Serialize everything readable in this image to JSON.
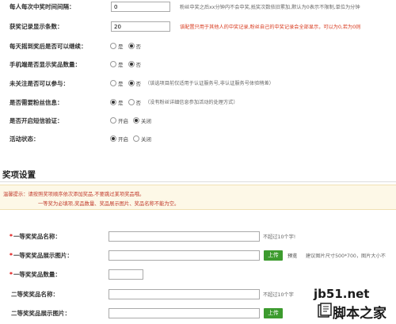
{
  "settings": {
    "interval": {
      "label": "每人每次中奖时间间隔：",
      "value": "0",
      "hint": "粉丝中奖之后xx分钟内不会中奖,抵奖次数依旧累加,默认为0表示不限制,单位为分钟"
    },
    "records": {
      "label": "获奖记录显示条数：",
      "value": "20",
      "hint": "该配置只用于其他人的中奖记录,粉丝自己的中奖记录会全部显示，可以为0,若为0则"
    },
    "continue_after_win": {
      "label": "每天摇到奖后是否可以继续：",
      "options": [
        "是",
        "否"
      ],
      "selected": 1
    },
    "mobile_show_count": {
      "label": "手机端是否显示奖品数量：",
      "options": [
        "是",
        "否"
      ],
      "selected": 1
    },
    "unfollowed_join": {
      "label": "未关注是否可以参与：",
      "options": [
        "是",
        "否"
      ],
      "selected": 1,
      "hint": "（该选项目前仅适用于认证服务号,非认证服务号体验稍差）"
    },
    "need_fan_info": {
      "label": "是否需要粉丝信息：",
      "options": [
        "是",
        "否"
      ],
      "selected": 0,
      "hint": "（没有粉丝详细信息参加活动的处理方式）"
    },
    "sms_verify": {
      "label": "是否开启短信验证：",
      "options": [
        "开启",
        "关闭"
      ],
      "selected": 1
    },
    "activity_status": {
      "label": "活动状态：",
      "options": [
        "开启",
        "关闭"
      ],
      "selected": 0
    }
  },
  "prize_section": {
    "title": "奖项设置",
    "notice_line1": "温馨提示：请按照奖项顺序依次添加奖品,不要跳过某项奖品哦。",
    "notice_line2": "一等奖为必填项,奖品数量、奖品展示图片、奖品名称不能为空。",
    "first_name": {
      "label": "一等奖奖品名称：",
      "value": "",
      "hint": "不超过10个字!"
    },
    "first_image": {
      "label": "一等奖奖品展示图片：",
      "value": "",
      "upload_label": "上传",
      "preview_label": "预览",
      "hint": "建议图片尺寸500*700，图片大小不"
    },
    "first_count": {
      "label": "一等奖奖品数量：",
      "value": ""
    },
    "second_name": {
      "label": "二等奖奖品名称：",
      "value": "",
      "hint": "不超过10个字"
    },
    "second_image": {
      "label": "二等奖奖品展示图片：",
      "value": "",
      "upload_label": "上传"
    }
  },
  "watermark": {
    "site": "jb51.net",
    "name": "脚本之家"
  }
}
